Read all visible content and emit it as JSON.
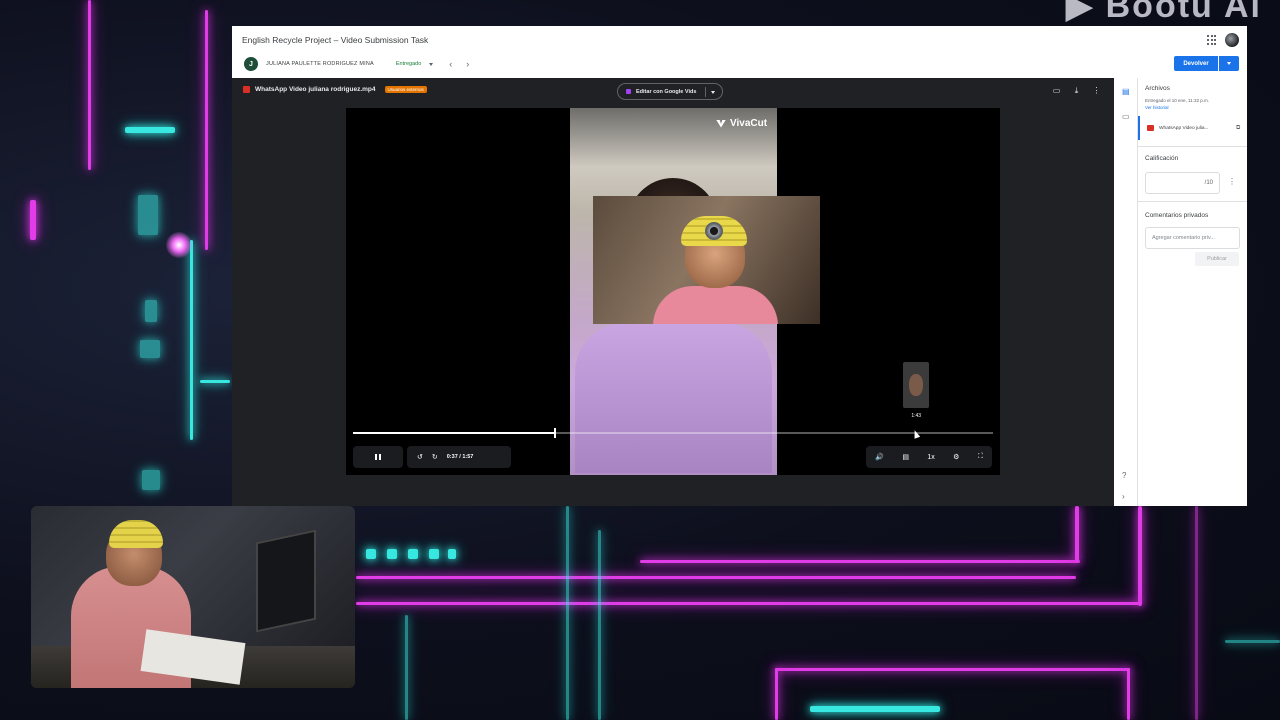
{
  "window_title": "English Recycle Project – Video Submission Task",
  "student": {
    "initial": "J",
    "name": "JULIANA PAULETTE RODRIGUEZ MINA",
    "status": "Entregado"
  },
  "header": {
    "return_label": "Devolver"
  },
  "viewer": {
    "file_name": "WhatsApp Video juliana rodriguez.mp4",
    "external_badge": "Usuarios externos",
    "edit_button": "Editar con Google Vids"
  },
  "video": {
    "watermark": "VivaCut",
    "current_time": "0:37",
    "duration": "1:57",
    "hover_time": "1:43",
    "progress_fraction": 0.316,
    "hover_fraction": 0.88,
    "speed": "1x"
  },
  "panel": {
    "files_heading": "Archivos",
    "submitted_text": "Entregado el 10 ene, 11:32 p.m.",
    "history_link": "Ver historial",
    "attached_file": "WhatsApp Video julia...",
    "grade_heading": "Calificación",
    "grade_suffix": "/10",
    "comments_heading": "Comentarios privados",
    "comment_placeholder": "Agregar comentario priv...",
    "publish_label": "Publicar"
  },
  "colors": {
    "accent": "#1a73e8",
    "status_green": "#188038",
    "neon_pink": "#e23be8",
    "neon_cyan": "#38e8e0"
  }
}
